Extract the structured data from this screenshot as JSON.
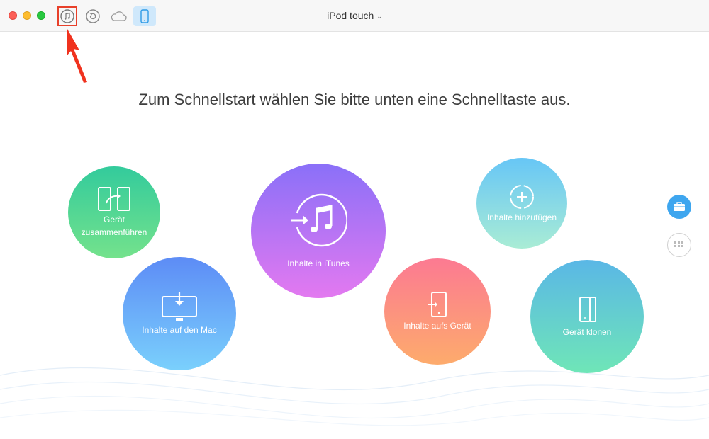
{
  "window": {
    "title": "iPod touch",
    "toolbar": {
      "itunes": "itunes-icon",
      "backup": "backup-history-icon",
      "cloud": "icloud-icon",
      "device": "device-icon"
    }
  },
  "main": {
    "headline": "Zum Schnellstart wählen Sie bitte unten eine Schnelltaste aus.",
    "shortcuts": [
      {
        "id": "merge",
        "label_line1": "Gerät",
        "label_line2": "zusammenführen",
        "color_top": "#33cb9c",
        "color_bottom": "#74e28c"
      },
      {
        "id": "to-mac",
        "label": "Inhalte auf den Mac",
        "color_top": "#5d8cf6",
        "color_bottom": "#7ad0fc"
      },
      {
        "id": "to-itunes",
        "label": "Inhalte in iTunes",
        "color_top": "#8a70f8",
        "color_bottom": "#e379f0"
      },
      {
        "id": "to-device",
        "label": "Inhalte aufs Gerät",
        "color_top": "#fc7a92",
        "color_bottom": "#fdab6c"
      },
      {
        "id": "add",
        "label": "Inhalte hinzufügen",
        "color_top": "#67c6f6",
        "color_bottom": "#a9ecd5"
      },
      {
        "id": "clone",
        "label": "Gerät klonen",
        "color_top": "#5ab7e6",
        "color_bottom": "#6fe6b7"
      }
    ]
  },
  "side": {
    "toolbox": "toolbox-icon",
    "categories": "grid-icon"
  },
  "colors": {
    "highlight": "#e8402a",
    "accent": "#3ea6ef"
  }
}
